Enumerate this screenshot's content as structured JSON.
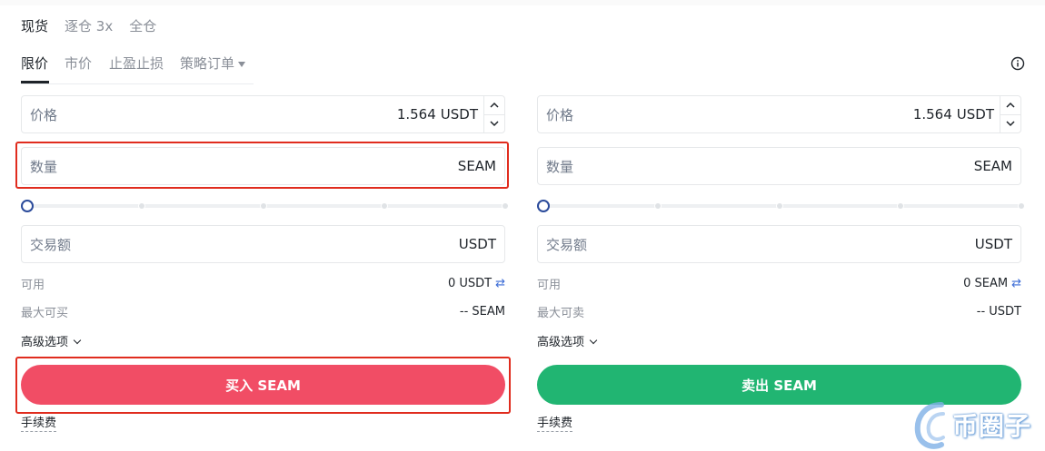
{
  "mode_tabs": [
    "现货",
    "逐仓 3x",
    "全仓"
  ],
  "order_tabs": [
    "限价",
    "市价",
    "止盈止损",
    "策略订单"
  ],
  "buy": {
    "price_label": "价格",
    "price_value": "1.564",
    "price_unit": "USDT",
    "amount_label": "数量",
    "amount_unit": "SEAM",
    "total_label": "交易额",
    "total_unit": "USDT",
    "slider_percent": 0,
    "available_label": "可用",
    "available_value": "0 USDT",
    "max_label": "最大可买",
    "max_value": "-- SEAM",
    "advanced_label": "高级选项",
    "button_label": "买入 SEAM",
    "fee_label": "手续费"
  },
  "sell": {
    "price_label": "价格",
    "price_value": "1.564",
    "price_unit": "USDT",
    "amount_label": "数量",
    "amount_unit": "SEAM",
    "total_label": "交易额",
    "total_unit": "USDT",
    "slider_percent": 0,
    "available_label": "可用",
    "available_value": "0 SEAM",
    "max_label": "最大可卖",
    "max_value": "-- USDT",
    "advanced_label": "高级选项",
    "button_label": "卖出 SEAM",
    "fee_label": "手续费"
  },
  "watermark": "币圈子",
  "colors": {
    "buy": "#f14d65",
    "sell": "#21b572",
    "highlight": "#e02c1e",
    "accent": "#2b4b9b"
  },
  "icons": {
    "info": "info-circle-icon",
    "swap": "swap-arrows-icon",
    "spin_up": "chevron-up-icon",
    "spin_down": "chevron-down-icon"
  }
}
